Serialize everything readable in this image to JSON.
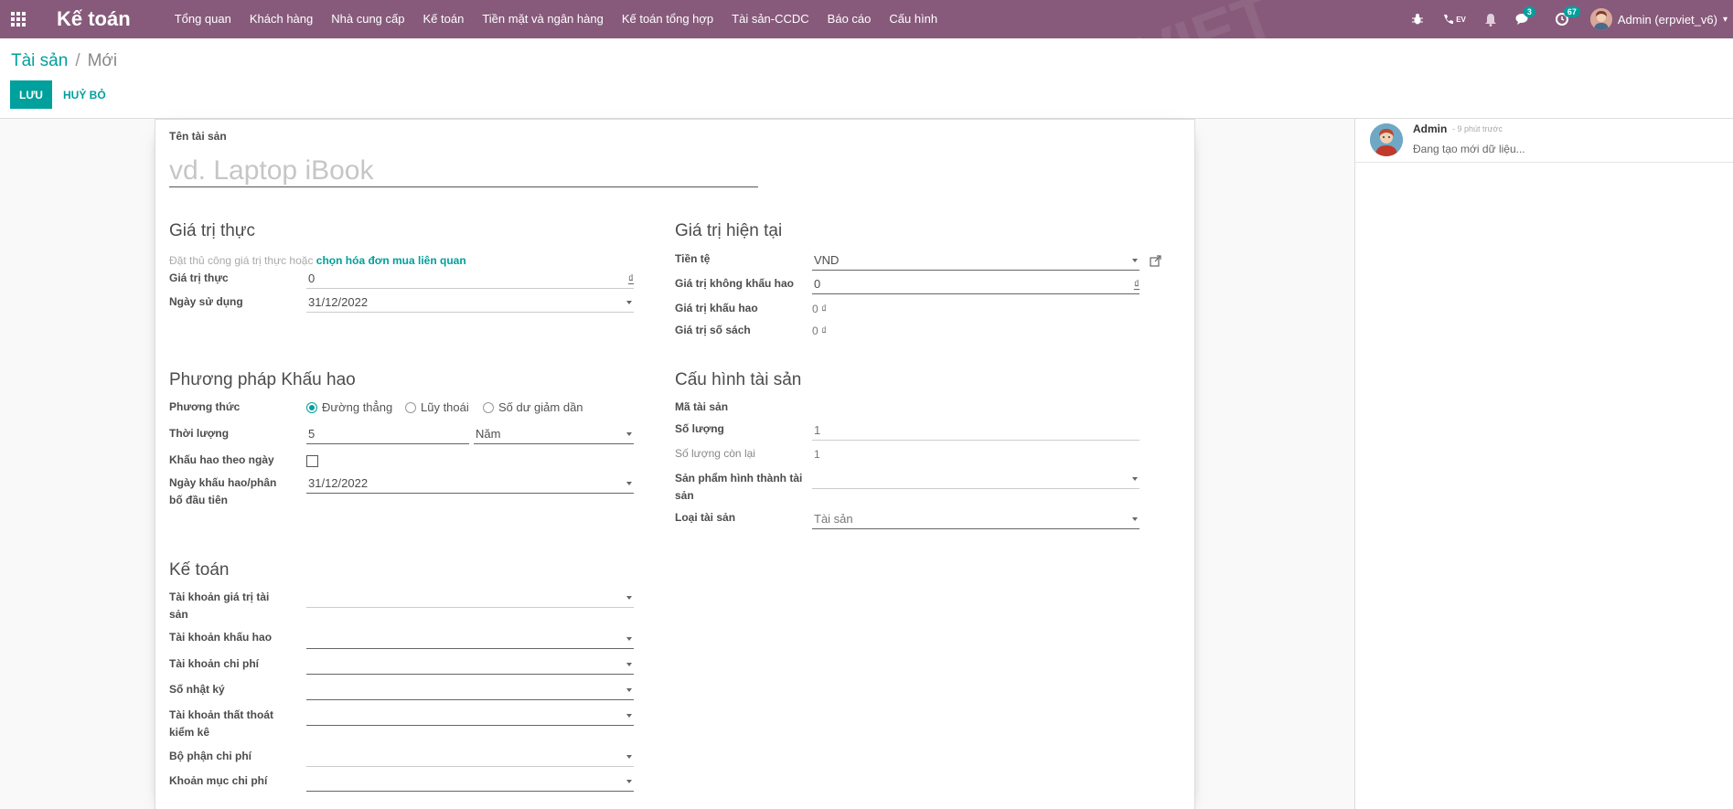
{
  "navbar": {
    "brand": "Kế toán",
    "menu": [
      "Tổng quan",
      "Khách hàng",
      "Nhà cung cấp",
      "Kế toán",
      "Tiền mặt và ngân hàng",
      "Kế toán tổng hợp",
      "Tài sản-CCDC",
      "Báo cáo",
      "Cấu hình"
    ],
    "systray": {
      "lang_label": "EV",
      "messages_badge": "3",
      "activities_badge": "67",
      "user_name": "Admin (erpviet_v6)"
    }
  },
  "breadcrumb": {
    "parent": "Tài sản",
    "separator": "/",
    "current": "Mới"
  },
  "buttons": {
    "save": "LƯU",
    "discard": "HUỶ BỎ"
  },
  "form": {
    "name_label": "Tên tài sản",
    "name_placeholder": "vd. Laptop iBook",
    "original_value": {
      "title": "Giá trị thực",
      "help_text": "Đặt thủ công giá trị thực hoặc",
      "help_link": "chọn hóa đơn mua liên quan",
      "value_label": "Giá trị thực",
      "value": "0",
      "currency_symbol": "₫",
      "date_label": "Ngày sử dụng",
      "date": "31/12/2022"
    },
    "current_value": {
      "title": "Giá trị hiện tại",
      "currency_label": "Tiền tệ",
      "currency": "VND",
      "non_dep_label": "Giá trị không khấu hao",
      "non_dep_value": "0",
      "currency_symbol": "₫",
      "dep_label": "Giá trị khấu hao",
      "dep_value": "0 ₫",
      "book_label": "Giá trị số sách",
      "book_value": "0 ₫"
    },
    "method": {
      "title": "Phương pháp Khấu hao",
      "method_label": "Phương thức",
      "options": [
        "Đường thẳng",
        "Lũy thoái",
        "Số dư giảm dần"
      ],
      "selected_index": 0,
      "duration_label": "Thời lượng",
      "duration": "5",
      "duration_unit": "Năm",
      "prorata_label": "Khấu hao theo ngày",
      "first_date_label": "Ngày khấu hao/phân bố đầu tiên",
      "first_date": "31/12/2022"
    },
    "config": {
      "title": "Cấu hình tài sản",
      "code_label": "Mã tài sản",
      "qty_label": "Số lượng",
      "qty": "1",
      "remaining_label": "Số lượng còn lại",
      "remaining": "1",
      "product_label": "Sản phẩm hình thành tài sản",
      "type_label": "Loại tài sản",
      "type": "Tài sản"
    },
    "accounting": {
      "title": "Kế toán",
      "fields": [
        "Tài khoản giá trị tài sản",
        "Tài khoản khấu hao",
        "Tài khoản chi phí",
        "Số nhật ký",
        "Tài khoản thất thoát kiểm kê",
        "Bộ phận chi phí",
        "Khoản mục chi phí"
      ]
    }
  },
  "chatter": {
    "author": "Admin",
    "time": "- 9 phút trước",
    "body": "Đang tạo mới dữ liệu..."
  }
}
